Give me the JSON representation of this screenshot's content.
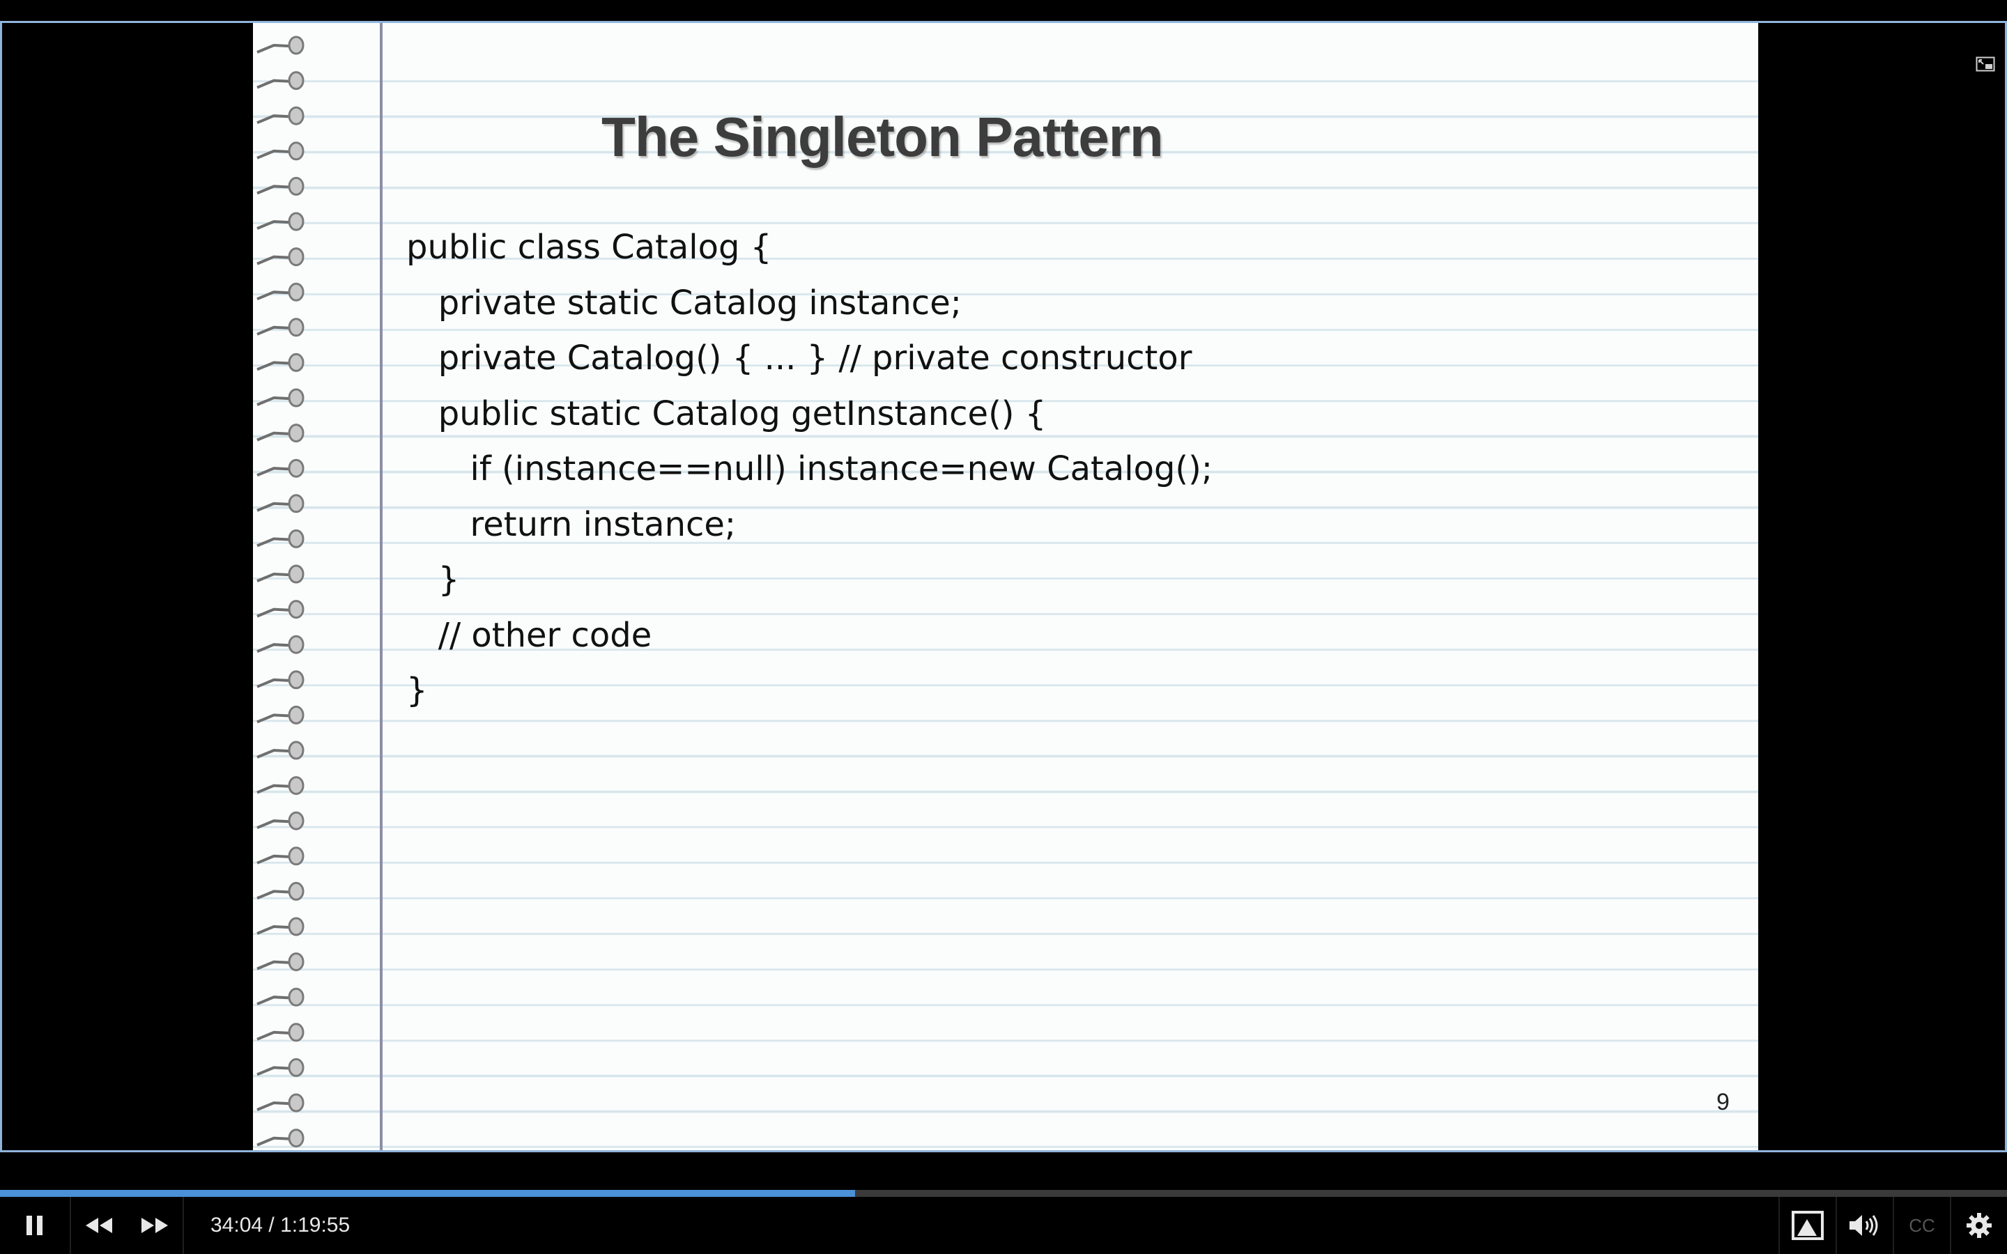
{
  "slide": {
    "title": "The Singleton Pattern",
    "code_lines": [
      "public class Catalog {",
      "   private static Catalog instance;",
      "   private Catalog() { ... } // private constructor",
      "   public static Catalog getInstance() {",
      "      if (instance==null) instance=new Catalog();",
      "      return instance;",
      "   }",
      "   // other code",
      "}"
    ],
    "page_number": "9"
  },
  "player": {
    "time_display": "34:04 / 1:19:55",
    "current_time": "34:04",
    "duration": "1:19:55",
    "progress_fraction": 0.426,
    "captions_label": "CC",
    "accent_color": "#4c90d8"
  },
  "icons": {
    "pause": "pause-icon",
    "rewind": "rewind-icon",
    "forward": "fast-forward-icon",
    "theater": "theater-mode-icon",
    "volume": "volume-icon",
    "settings": "gear-icon",
    "pip": "picture-in-picture-icon"
  }
}
